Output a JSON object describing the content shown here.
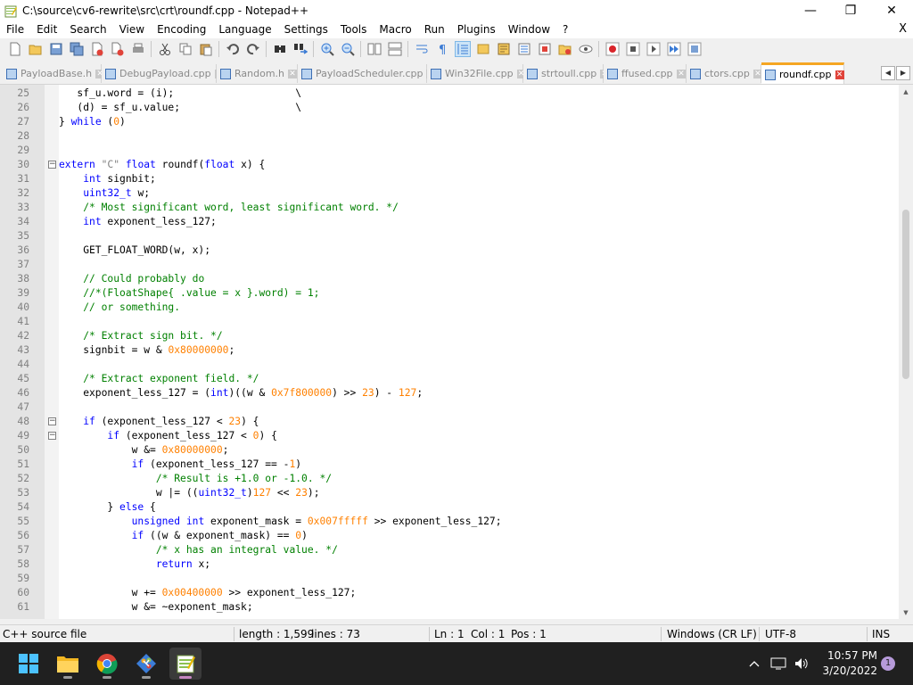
{
  "window": {
    "title": "C:\\source\\cv6-rewrite\\src\\crt\\roundf.cpp - Notepad++",
    "minimize_glyph": "—",
    "maximize_glyph": "❐",
    "close_glyph": "✕"
  },
  "menu": {
    "items": [
      "File",
      "Edit",
      "Search",
      "View",
      "Encoding",
      "Language",
      "Settings",
      "Tools",
      "Macro",
      "Run",
      "Plugins",
      "Window",
      "?"
    ],
    "close_label": "X"
  },
  "toolbar": {
    "icons": [
      "new-file-icon",
      "open-file-icon",
      "save-icon",
      "save-all-icon",
      "close-icon",
      "close-all-icon",
      "print-icon",
      "cut-icon",
      "copy-icon",
      "paste-icon",
      "undo-icon",
      "redo-icon",
      "find-icon",
      "replace-icon",
      "zoom-in-icon",
      "zoom-out-icon",
      "sync-vertical-icon",
      "sync-horizontal-icon",
      "word-wrap-icon",
      "show-all-chars-icon",
      "indent-guide-icon",
      "user-language-icon",
      "doc-map-icon",
      "function-list-icon",
      "folder-workspace-icon",
      "monitoring-icon",
      "record-macro-icon",
      "stop-record-icon",
      "play-macro-icon",
      "run-macro-multiple-icon",
      "save-macro-icon"
    ]
  },
  "tabs": {
    "items": [
      {
        "label": "PayloadBase.h",
        "active": false
      },
      {
        "label": "DebugPayload.cpp",
        "active": false
      },
      {
        "label": "Random.h",
        "active": false
      },
      {
        "label": "PayloadScheduler.cpp",
        "active": false
      },
      {
        "label": "Win32File.cpp",
        "active": false
      },
      {
        "label": "strtoull.cpp",
        "active": false
      },
      {
        "label": "ffused.cpp",
        "active": false
      },
      {
        "label": "ctors.cpp",
        "active": false
      },
      {
        "label": "roundf.cpp",
        "active": true
      }
    ],
    "close_glyph": "✕",
    "prev_glyph": "◀",
    "next_glyph": "▶"
  },
  "editor": {
    "lines": [
      {
        "n": "25",
        "t": [
          [
            "tx",
            "   sf_u.word = (i);                    \\"
          ]
        ]
      },
      {
        "n": "26",
        "t": [
          [
            "tx",
            "   (d) = sf_u.value;                   \\"
          ]
        ]
      },
      {
        "n": "27",
        "t": [
          [
            "tx",
            "} "
          ],
          [
            "kw",
            "while"
          ],
          [
            "tx",
            " ("
          ],
          [
            "num",
            "0"
          ],
          [
            "tx",
            ")"
          ]
        ]
      },
      {
        "n": "28",
        "t": []
      },
      {
        "n": "29",
        "t": []
      },
      {
        "n": "30",
        "fold": "minus",
        "t": [
          [
            "kw",
            "extern"
          ],
          [
            "tx",
            " "
          ],
          [
            "str",
            "\"C\""
          ],
          [
            "tx",
            " "
          ],
          [
            "kw",
            "float"
          ],
          [
            "tx",
            " roundf("
          ],
          [
            "kw",
            "float"
          ],
          [
            "tx",
            " x) {"
          ]
        ]
      },
      {
        "n": "31",
        "t": [
          [
            "tx",
            "    "
          ],
          [
            "kw",
            "int"
          ],
          [
            "tx",
            " signbit;"
          ]
        ]
      },
      {
        "n": "32",
        "t": [
          [
            "tx",
            "    "
          ],
          [
            "kw",
            "uint32_t"
          ],
          [
            "tx",
            " w;"
          ]
        ]
      },
      {
        "n": "33",
        "t": [
          [
            "tx",
            "    "
          ],
          [
            "cm",
            "/* Most significant word, least significant word. */"
          ]
        ]
      },
      {
        "n": "34",
        "t": [
          [
            "tx",
            "    "
          ],
          [
            "kw",
            "int"
          ],
          [
            "tx",
            " exponent_less_127;"
          ]
        ]
      },
      {
        "n": "35",
        "t": []
      },
      {
        "n": "36",
        "t": [
          [
            "tx",
            "    GET_FLOAT_WORD(w, x);"
          ]
        ]
      },
      {
        "n": "37",
        "t": []
      },
      {
        "n": "38",
        "t": [
          [
            "tx",
            "    "
          ],
          [
            "cm",
            "// Could probably do"
          ]
        ]
      },
      {
        "n": "39",
        "t": [
          [
            "tx",
            "    "
          ],
          [
            "cm",
            "//*(FloatShape{ .value = x }.word) = 1;"
          ]
        ]
      },
      {
        "n": "40",
        "t": [
          [
            "tx",
            "    "
          ],
          [
            "cm",
            "// or something."
          ]
        ]
      },
      {
        "n": "41",
        "t": []
      },
      {
        "n": "42",
        "t": [
          [
            "tx",
            "    "
          ],
          [
            "cm",
            "/* Extract sign bit. */"
          ]
        ]
      },
      {
        "n": "43",
        "t": [
          [
            "tx",
            "    signbit = w & "
          ],
          [
            "num",
            "0x80000000"
          ],
          [
            "tx",
            ";"
          ]
        ]
      },
      {
        "n": "44",
        "t": []
      },
      {
        "n": "45",
        "t": [
          [
            "tx",
            "    "
          ],
          [
            "cm",
            "/* Extract exponent field. */"
          ]
        ]
      },
      {
        "n": "46",
        "t": [
          [
            "tx",
            "    exponent_less_127 = ("
          ],
          [
            "kw",
            "int"
          ],
          [
            "tx",
            ")((w & "
          ],
          [
            "num",
            "0x7f800000"
          ],
          [
            "tx",
            ") >> "
          ],
          [
            "num",
            "23"
          ],
          [
            "tx",
            ") - "
          ],
          [
            "num",
            "127"
          ],
          [
            "tx",
            ";"
          ]
        ]
      },
      {
        "n": "47",
        "t": []
      },
      {
        "n": "48",
        "fold": "minus",
        "t": [
          [
            "tx",
            "    "
          ],
          [
            "kw",
            "if"
          ],
          [
            "tx",
            " (exponent_less_127 < "
          ],
          [
            "num",
            "23"
          ],
          [
            "tx",
            ") {"
          ]
        ]
      },
      {
        "n": "49",
        "fold": "minus",
        "t": [
          [
            "tx",
            "        "
          ],
          [
            "kw",
            "if"
          ],
          [
            "tx",
            " (exponent_less_127 < "
          ],
          [
            "num",
            "0"
          ],
          [
            "tx",
            ") {"
          ]
        ]
      },
      {
        "n": "50",
        "t": [
          [
            "tx",
            "            w &= "
          ],
          [
            "num",
            "0x80000000"
          ],
          [
            "tx",
            ";"
          ]
        ]
      },
      {
        "n": "51",
        "t": [
          [
            "tx",
            "            "
          ],
          [
            "kw",
            "if"
          ],
          [
            "tx",
            " (exponent_less_127 == -"
          ],
          [
            "num",
            "1"
          ],
          [
            "tx",
            ")"
          ]
        ]
      },
      {
        "n": "52",
        "t": [
          [
            "tx",
            "                "
          ],
          [
            "cm",
            "/* Result is +1.0 or -1.0. */"
          ]
        ]
      },
      {
        "n": "53",
        "t": [
          [
            "tx",
            "                w |= (("
          ],
          [
            "kw",
            "uint32_t"
          ],
          [
            "tx",
            ")"
          ],
          [
            "num",
            "127"
          ],
          [
            "tx",
            " << "
          ],
          [
            "num",
            "23"
          ],
          [
            "tx",
            ");"
          ]
        ]
      },
      {
        "n": "54",
        "t": [
          [
            "tx",
            "        } "
          ],
          [
            "kw",
            "else"
          ],
          [
            "tx",
            " {"
          ]
        ]
      },
      {
        "n": "55",
        "t": [
          [
            "tx",
            "            "
          ],
          [
            "kw",
            "unsigned int"
          ],
          [
            "tx",
            " exponent_mask = "
          ],
          [
            "num",
            "0x007fffff"
          ],
          [
            "tx",
            " >> exponent_less_127;"
          ]
        ]
      },
      {
        "n": "56",
        "t": [
          [
            "tx",
            "            "
          ],
          [
            "kw",
            "if"
          ],
          [
            "tx",
            " ((w & exponent_mask) == "
          ],
          [
            "num",
            "0"
          ],
          [
            "tx",
            ")"
          ]
        ]
      },
      {
        "n": "57",
        "t": [
          [
            "tx",
            "                "
          ],
          [
            "cm",
            "/* x has an integral value. */"
          ]
        ]
      },
      {
        "n": "58",
        "t": [
          [
            "tx",
            "                "
          ],
          [
            "kw",
            "return"
          ],
          [
            "tx",
            " x;"
          ]
        ]
      },
      {
        "n": "59",
        "t": []
      },
      {
        "n": "60",
        "t": [
          [
            "tx",
            "            w += "
          ],
          [
            "num",
            "0x00400000"
          ],
          [
            "tx",
            " >> exponent_less_127;"
          ]
        ]
      },
      {
        "n": "61",
        "t": [
          [
            "tx",
            "            w &= ~exponent_mask;"
          ]
        ]
      }
    ]
  },
  "status": {
    "filetype": "C++ source file",
    "length": "length : 1,599",
    "lines": "lines : 73",
    "ln": "Ln : 1",
    "col": "Col : 1",
    "pos": "Pos : 1",
    "eol": "Windows (CR LF)",
    "encoding": "UTF-8",
    "mode": "INS"
  },
  "taskbar": {
    "apps": [
      "windows-start-icon",
      "file-explorer-icon",
      "chrome-icon",
      "git-tool-icon",
      "notepadpp-icon"
    ],
    "time": "10:57 PM",
    "date": "3/20/2022",
    "notification_count": "1"
  },
  "colors": {
    "keyword": "#0000ff",
    "comment": "#008000",
    "number": "#ff8000",
    "string": "#808080",
    "active_tab_accent": "#f5a623",
    "taskbar": "#202020"
  }
}
